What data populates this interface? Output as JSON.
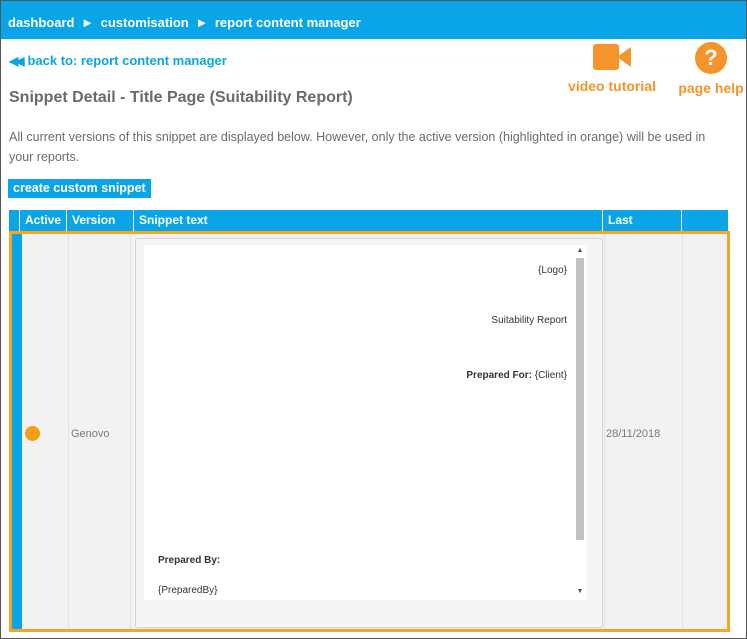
{
  "breadcrumb": {
    "items": [
      "dashboard",
      "customisation",
      "report content manager"
    ],
    "separator": "►"
  },
  "back_link": {
    "label": "back to: report content manager"
  },
  "page_title": "Snippet Detail - Title Page (Suitability Report)",
  "help": {
    "video_label": "video tutorial",
    "help_label": "page help"
  },
  "intro_text": "All current versions of this snippet are displayed below. However, only the active version (highlighted in orange) will be used in your reports.",
  "create_button": "create custom snippet",
  "table": {
    "headers": [
      "Active",
      "Version",
      "Snippet text",
      "Last Updated"
    ],
    "rows": [
      {
        "version": "Genovo",
        "last_updated": "28/11/2018",
        "snippet": {
          "logo": "{Logo}",
          "report_name": "Suitability Report",
          "prepared_for_label": "Prepared For:",
          "prepared_for_value": " {Client}",
          "prepared_by_label": "Prepared By:",
          "prepared_by_value": "{PreparedBy}"
        }
      }
    ]
  },
  "colors": {
    "accent_blue": "#0aa5e8",
    "accent_orange": "#f5942a",
    "active_border": "#f5a623"
  }
}
